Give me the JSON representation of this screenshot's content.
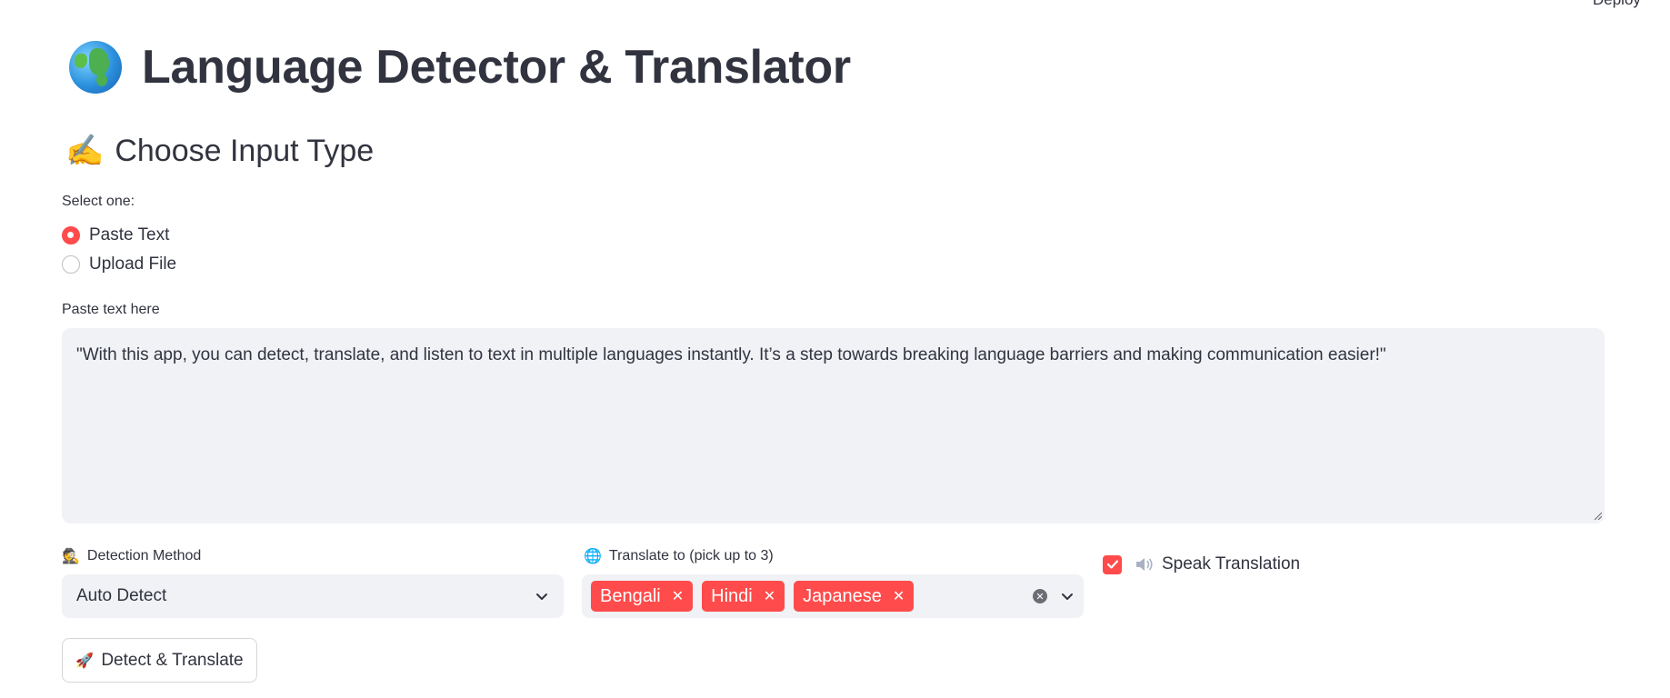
{
  "header": {
    "deploy_label": "Deploy"
  },
  "page_title": "Language Detector & Translator",
  "section": {
    "title": "Choose Input Type"
  },
  "input_type": {
    "label": "Select one:",
    "options": [
      {
        "label": "Paste Text",
        "selected": true
      },
      {
        "label": "Upload File",
        "selected": false
      }
    ]
  },
  "text_input": {
    "label": "Paste text here",
    "value": "\"With this app, you can detect, translate, and listen to text in multiple languages instantly. It’s a step towards breaking language barriers and making communication easier!\""
  },
  "detection": {
    "label": "Detection Method",
    "emoji": "🕵",
    "value": "Auto Detect"
  },
  "translate": {
    "label": "Translate to (pick up to 3)",
    "emoji": "🌐",
    "selected": [
      "Bengali",
      "Hindi",
      "Japanese"
    ]
  },
  "speak": {
    "label": "Speak Translation",
    "checked": true
  },
  "action": {
    "label": "Detect & Translate"
  },
  "colors": {
    "accent": "#ff4b4b",
    "field_bg": "#f0f2f6",
    "text": "#31333f"
  }
}
